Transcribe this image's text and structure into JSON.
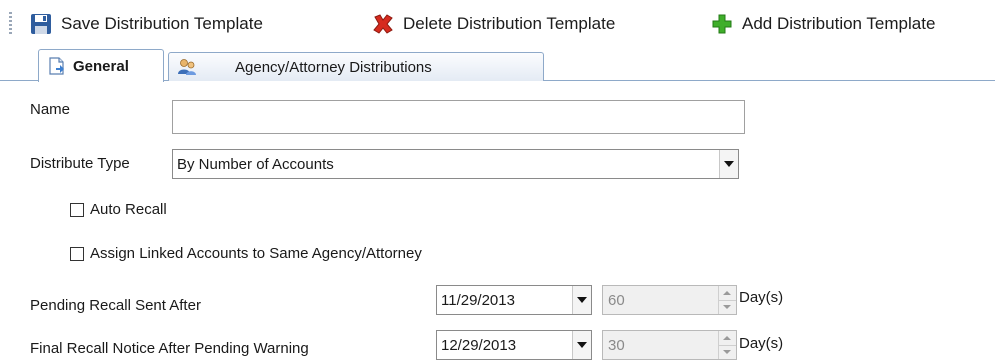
{
  "toolbar": {
    "save_label": "Save Distribution Template",
    "delete_label": "Delete Distribution Template",
    "add_label": "Add Distribution Template"
  },
  "tabs": [
    {
      "label": "General",
      "active": true
    },
    {
      "label": "Agency/Attorney Distributions",
      "active": false
    }
  ],
  "form": {
    "name_label": "Name",
    "name_value": "",
    "distribute_type_label": "Distribute Type",
    "distribute_type_value": "By Number of Accounts",
    "auto_recall_label": "Auto Recall",
    "auto_recall_checked": false,
    "assign_linked_label": "Assign Linked Accounts to Same Agency/Attorney",
    "assign_linked_checked": false,
    "pending_recall_label": "Pending Recall Sent After",
    "pending_recall_date": "11/29/2013",
    "pending_recall_days": "60",
    "final_recall_label": "Final Recall Notice After Pending Warning",
    "final_recall_date": "12/29/2013",
    "final_recall_days": "30",
    "days_unit": "Day(s)"
  },
  "colors": {
    "tab_border": "#8ea9c9",
    "save_icon": "#2f5d9e",
    "delete_icon": "#d62a1e",
    "add_icon": "#3fae2a"
  }
}
